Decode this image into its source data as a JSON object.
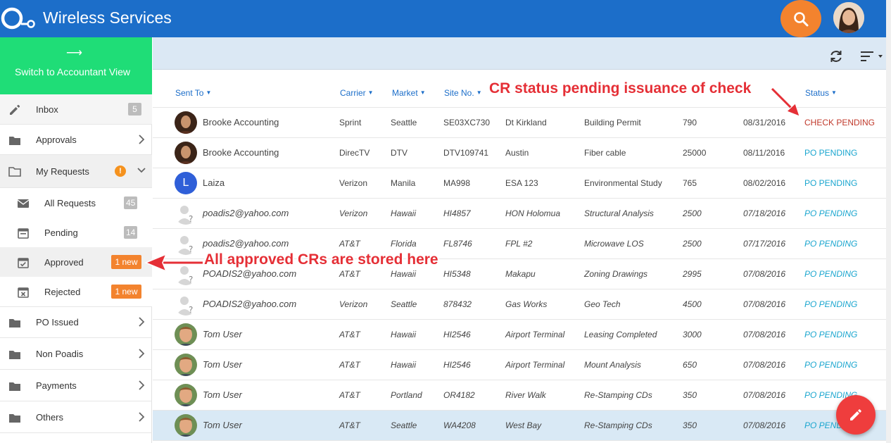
{
  "header": {
    "title": "Wireless Services"
  },
  "sidebar": {
    "switch_label": "Switch to Accountant View",
    "items": [
      {
        "label": "Inbox",
        "count": "5"
      },
      {
        "label": "Approvals"
      },
      {
        "label": "My Requests",
        "alert": "!"
      },
      {
        "label": "All Requests",
        "count": "45"
      },
      {
        "label": "Pending",
        "count": "14"
      },
      {
        "label": "Approved",
        "badge": "1 new"
      },
      {
        "label": "Rejected",
        "badge": "1 new"
      },
      {
        "label": "PO Issued"
      },
      {
        "label": "Non Poadis"
      },
      {
        "label": "Payments"
      },
      {
        "label": "Others"
      }
    ]
  },
  "table": {
    "columns": [
      "Sent To",
      "Carrier",
      "Market",
      "Site No.",
      "Status"
    ],
    "rows": [
      {
        "sent_to": "Brooke Accounting",
        "carrier": "Sprint",
        "market": "Seattle",
        "site_no": "SE03XC730",
        "site_name": "Dt Kirkland",
        "service": "Building Permit",
        "amount": "790",
        "date": "08/31/2016",
        "status": "CHECK PENDING"
      },
      {
        "sent_to": "Brooke Accounting",
        "carrier": "DirecTV",
        "market": "DTV",
        "site_no": "DTV109741",
        "site_name": "Austin",
        "service": "Fiber cable",
        "amount": "25000",
        "date": "08/11/2016",
        "status": "PO PENDING"
      },
      {
        "sent_to": "Laiza",
        "initial": "L",
        "carrier": "Verizon",
        "market": "Manila",
        "site_no": "MA998",
        "site_name": "ESA 123",
        "service": "Environmental Study",
        "amount": "765",
        "date": "08/02/2016",
        "status": "PO PENDING"
      },
      {
        "sent_to": "poadis2@yahoo.com",
        "carrier": "Verizon",
        "market": "Hawaii",
        "site_no": "HI4857",
        "site_name": "HON Holomua",
        "service": "Structural Analysis",
        "amount": "2500",
        "date": "07/18/2016",
        "status": "PO PENDING"
      },
      {
        "sent_to": "poadis2@yahoo.com",
        "carrier": "AT&T",
        "market": "Florida",
        "site_no": "FL8746",
        "site_name": "FPL #2",
        "service": "Microwave LOS",
        "amount": "2500",
        "date": "07/17/2016",
        "status": "PO PENDING"
      },
      {
        "sent_to": "POADIS2@yahoo.com",
        "carrier": "AT&T",
        "market": "Hawaii",
        "site_no": "HI5348",
        "site_name": "Makapu",
        "service": "Zoning Drawings",
        "amount": "2995",
        "date": "07/08/2016",
        "status": "PO PENDING"
      },
      {
        "sent_to": "POADIS2@yahoo.com",
        "carrier": "Verizon",
        "market": "Seattle",
        "site_no": "878432",
        "site_name": "Gas Works",
        "service": "Geo Tech",
        "amount": "4500",
        "date": "07/08/2016",
        "status": "PO PENDING"
      },
      {
        "sent_to": "Tom User",
        "carrier": "AT&T",
        "market": "Hawaii",
        "site_no": "HI2546",
        "site_name": "Airport Terminal",
        "service": "Leasing Completed",
        "amount": "3000",
        "date": "07/08/2016",
        "status": "PO PENDING"
      },
      {
        "sent_to": "Tom User",
        "carrier": "AT&T",
        "market": "Hawaii",
        "site_no": "HI2546",
        "site_name": "Airport Terminal",
        "service": "Mount Analysis",
        "amount": "650",
        "date": "07/08/2016",
        "status": "PO PENDING"
      },
      {
        "sent_to": "Tom User",
        "carrier": "AT&T",
        "market": "Portland",
        "site_no": "OR4182",
        "site_name": "River Walk",
        "service": "Re-Stamping CDs",
        "amount": "350",
        "date": "07/08/2016",
        "status": "PO PENDING"
      },
      {
        "sent_to": "Tom User",
        "carrier": "AT&T",
        "market": "Seattle",
        "site_no": "WA4208",
        "site_name": "West Bay",
        "service": "Re-Stamping CDs",
        "amount": "350",
        "date": "07/08/2016",
        "status": "PO PENDING"
      }
    ]
  },
  "annotations": {
    "status_note": "CR status pending issuance of check",
    "approved_note": "All approved CRs are stored here"
  },
  "colors": {
    "header": "#1c6ec9",
    "accent": "#f3832e",
    "switch": "#1fdd77",
    "status_po": "#1ba6cf",
    "status_check": "#c0392b",
    "fab": "#ef3d3d"
  }
}
